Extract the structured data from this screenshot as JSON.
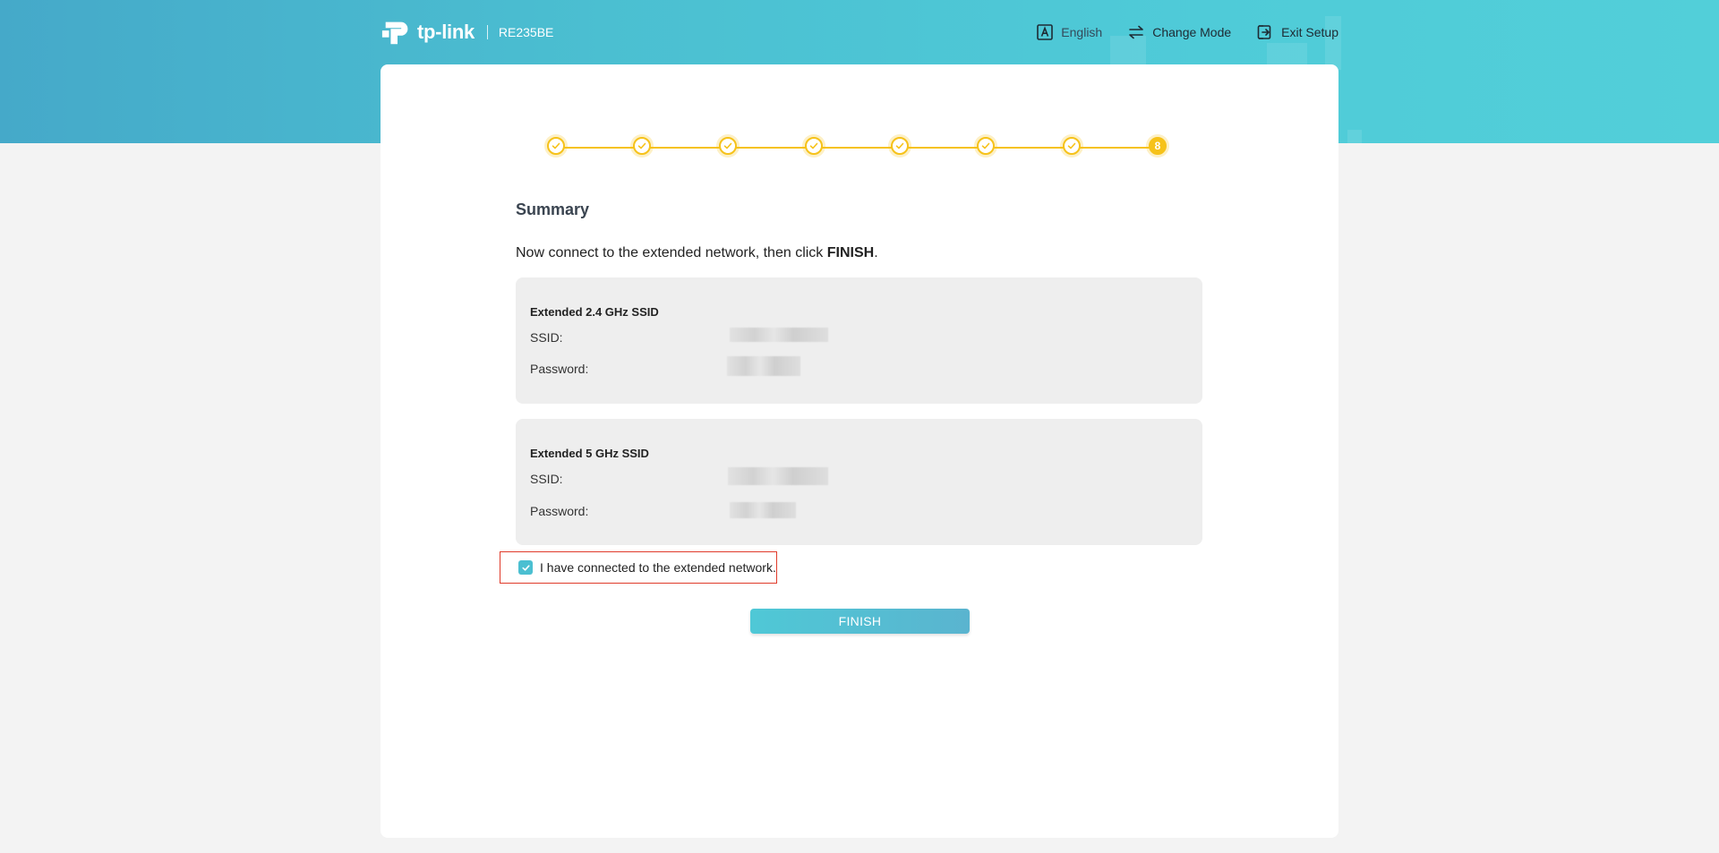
{
  "header": {
    "brand": "tp-link",
    "model": "RE235BE",
    "nav": {
      "language": "English",
      "change_mode": "Change Mode",
      "exit_setup": "Exit Setup"
    }
  },
  "stepper": {
    "total_steps": 8,
    "completed_steps": 7,
    "current_step_label": "8"
  },
  "summary": {
    "title": "Summary",
    "intro_prefix": "Now connect to the extended network, then click ",
    "intro_bold": "FINISH",
    "intro_suffix": "."
  },
  "networks": [
    {
      "title": "Extended 2.4 GHz SSID",
      "ssid_label": "SSID:",
      "password_label": "Password:"
    },
    {
      "title": "Extended 5 GHz SSID",
      "ssid_label": "SSID:",
      "password_label": "Password:"
    }
  ],
  "confirm": {
    "label": "I have connected to the extended network.",
    "checked": true
  },
  "actions": {
    "finish_label": "FINISH"
  },
  "colors": {
    "accent": "#4bbfd1",
    "step_color": "#f6c21a",
    "highlight_border": "#e03a2a"
  }
}
